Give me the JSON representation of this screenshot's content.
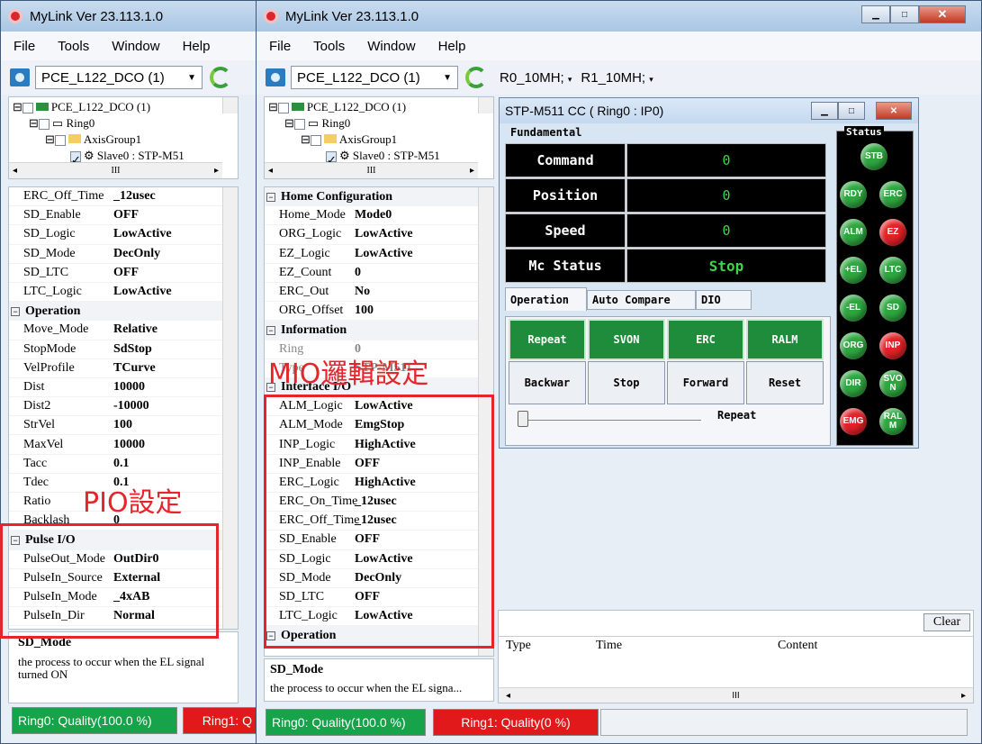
{
  "app": {
    "title": "MyLink  Ver 23.113.1.0"
  },
  "menu": [
    "File",
    "Tools",
    "Window",
    "Help"
  ],
  "toolbar": {
    "device": "PCE_L122_DCO (1)",
    "ring0_rate": "R0_10MH;",
    "ring1_rate": "R1_10MH;"
  },
  "tree": {
    "root": "PCE_L122_DCO (1)",
    "ring": "Ring0",
    "group": "AxisGroup1",
    "slave": "Slave0 : STP-M51",
    "scroll_mid": "III"
  },
  "left_grid": {
    "rows_top": [
      {
        "k": "ERC_Off_Time",
        "v": "_12usec"
      },
      {
        "k": "SD_Enable",
        "v": "OFF"
      },
      {
        "k": "SD_Logic",
        "v": "LowActive"
      },
      {
        "k": "SD_Mode",
        "v": "DecOnly"
      },
      {
        "k": "SD_LTC",
        "v": "OFF"
      },
      {
        "k": "LTC_Logic",
        "v": "LowActive"
      }
    ],
    "section_operation": "Operation",
    "rows_op": [
      {
        "k": "Move_Mode",
        "v": "Relative"
      },
      {
        "k": "StopMode",
        "v": "SdStop"
      },
      {
        "k": "VelProfile",
        "v": "TCurve"
      },
      {
        "k": "Dist",
        "v": "10000"
      },
      {
        "k": "Dist2",
        "v": "-10000"
      },
      {
        "k": "StrVel",
        "v": "100"
      },
      {
        "k": "MaxVel",
        "v": "10000"
      },
      {
        "k": "Tacc",
        "v": "0.1"
      },
      {
        "k": "Tdec",
        "v": "0.1"
      },
      {
        "k": "Ratio",
        "v": ""
      },
      {
        "k": "Backlash",
        "v": "0"
      }
    ],
    "section_pulse": "Pulse I/O",
    "rows_pulse": [
      {
        "k": "PulseOut_Mode",
        "v": "OutDir0"
      },
      {
        "k": "PulseIn_Source",
        "v": "External"
      },
      {
        "k": "PulseIn_Mode",
        "v": "_4xAB"
      },
      {
        "k": "PulseIn_Dir",
        "v": "Normal"
      }
    ]
  },
  "right_grid": {
    "section_home": "Home Configuration",
    "rows_home": [
      {
        "k": "Home_Mode",
        "v": "Mode0"
      },
      {
        "k": "ORG_Logic",
        "v": "LowActive"
      },
      {
        "k": "EZ_Logic",
        "v": "LowActive"
      },
      {
        "k": "EZ_Count",
        "v": "0"
      },
      {
        "k": "ERC_Out",
        "v": "No"
      },
      {
        "k": "ORG_Offset",
        "v": "100"
      }
    ],
    "section_info": "Information",
    "rows_info": [
      {
        "k": "Ring",
        "v": "0"
      },
      {
        "k": "Type",
        "v": "STP-M511"
      }
    ],
    "section_iface": "Interface I/O",
    "rows_iface": [
      {
        "k": "ALM_Logic",
        "v": "LowActive"
      },
      {
        "k": "ALM_Mode",
        "v": "EmgStop"
      },
      {
        "k": "INP_Logic",
        "v": "HighActive"
      },
      {
        "k": "INP_Enable",
        "v": "OFF"
      },
      {
        "k": "ERC_Logic",
        "v": "HighActive"
      },
      {
        "k": "ERC_On_Time",
        "v": "_12usec"
      },
      {
        "k": "ERC_Off_Time",
        "v": "_12usec"
      },
      {
        "k": "SD_Enable",
        "v": "OFF"
      },
      {
        "k": "SD_Logic",
        "v": "LowActive"
      },
      {
        "k": "SD_Mode",
        "v": "DecOnly"
      },
      {
        "k": "SD_LTC",
        "v": "OFF"
      },
      {
        "k": "LTC_Logic",
        "v": "LowActive"
      }
    ],
    "section_operation_partial": "Operation"
  },
  "description": {
    "title": "SD_Mode",
    "text_left": "the process to occur when the EL signal turned ON",
    "text_right": "the process to occur when the EL signa..."
  },
  "annotations": {
    "pio": "PIO設定",
    "mio": "MIO邏輯設定"
  },
  "statusbar": {
    "ring0": "Ring0: Quality(100.0 %)",
    "ring1_left": "Ring1: Q",
    "ring1": "Ring1: Quality(0 %)"
  },
  "axis_window": {
    "title": "STP-M511 CC ( Ring0 : IP0)",
    "fundamental_label": "Fundamental",
    "status_label": "Status",
    "rows": [
      {
        "label": "Command",
        "value": "0"
      },
      {
        "label": "Position",
        "value": "0"
      },
      {
        "label": "Speed",
        "value": "0"
      },
      {
        "label": "Mc Status",
        "value": "Stop"
      }
    ],
    "tabs": [
      "Operation",
      "Auto Compare",
      "DIO"
    ],
    "buttons_row1": [
      "Repeat",
      "SVON",
      "ERC",
      "RALM"
    ],
    "buttons_row2": [
      "Backwar",
      "Stop",
      "Forward",
      "Reset"
    ],
    "slider_label": "Repeat",
    "leds": [
      {
        "label": "STB",
        "color": "green"
      },
      {
        "label": "RDY",
        "color": "green"
      },
      {
        "label": "ERC",
        "color": "green"
      },
      {
        "label": "ALM",
        "color": "green"
      },
      {
        "label": "EZ",
        "color": "red"
      },
      {
        "label": "+EL",
        "color": "green"
      },
      {
        "label": "LTC",
        "color": "green"
      },
      {
        "label": "-EL",
        "color": "green"
      },
      {
        "label": "SD",
        "color": "green"
      },
      {
        "label": "ORG",
        "color": "green"
      },
      {
        "label": "INP",
        "color": "red"
      },
      {
        "label": "DIR",
        "color": "green"
      },
      {
        "label": "SVO N",
        "color": "green"
      },
      {
        "label": "EMG",
        "color": "red"
      },
      {
        "label": "RAL M",
        "color": "green"
      }
    ]
  },
  "log": {
    "clear_label": "Clear",
    "columns": [
      "Type",
      "Time",
      "Content"
    ],
    "scroll_mid": "III"
  }
}
